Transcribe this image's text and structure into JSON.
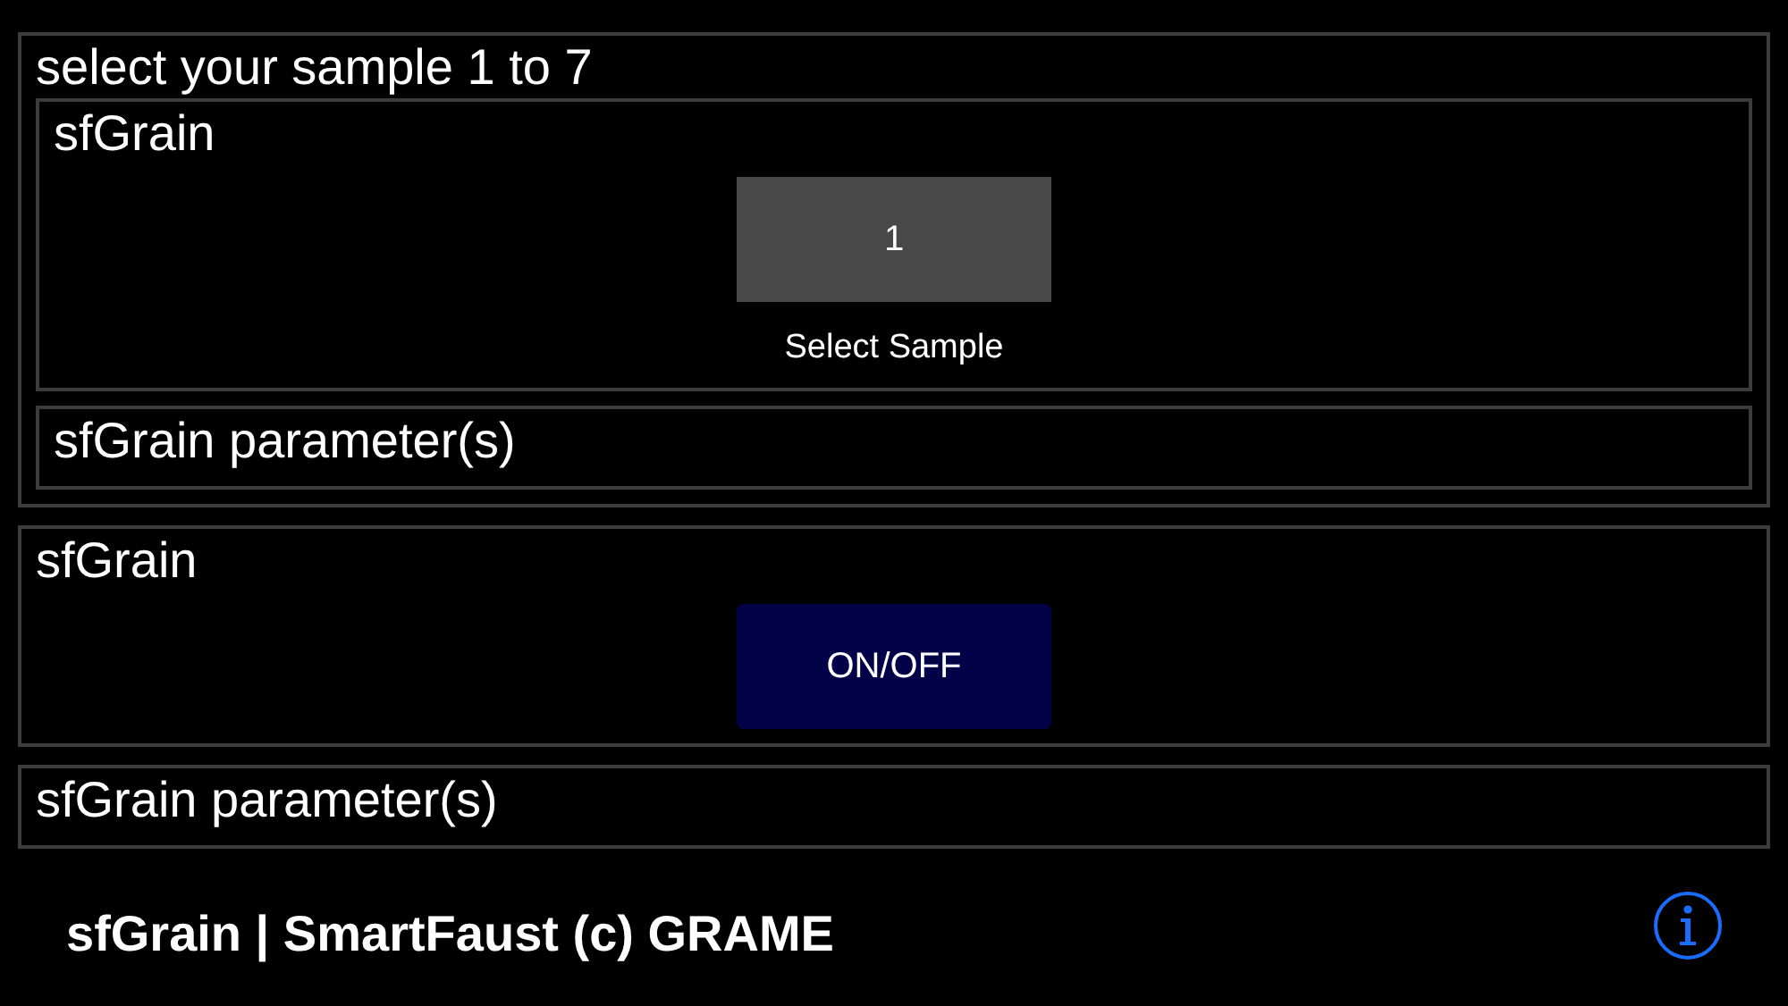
{
  "groups": [
    {
      "title": "select your sample 1 to 7",
      "children": [
        {
          "title": "sfGrain",
          "controls": [
            {
              "kind": "number_button",
              "value": "1",
              "label": "Select Sample"
            }
          ]
        },
        {
          "title": "sfGrain parameter(s)"
        }
      ]
    },
    {
      "title": "sfGrain",
      "controls": [
        {
          "kind": "toggle_button",
          "label": "ON/OFF"
        }
      ]
    },
    {
      "title": "sfGrain parameter(s)"
    }
  ],
  "footer": {
    "text": "sfGrain | SmartFaust (c) GRAME"
  }
}
